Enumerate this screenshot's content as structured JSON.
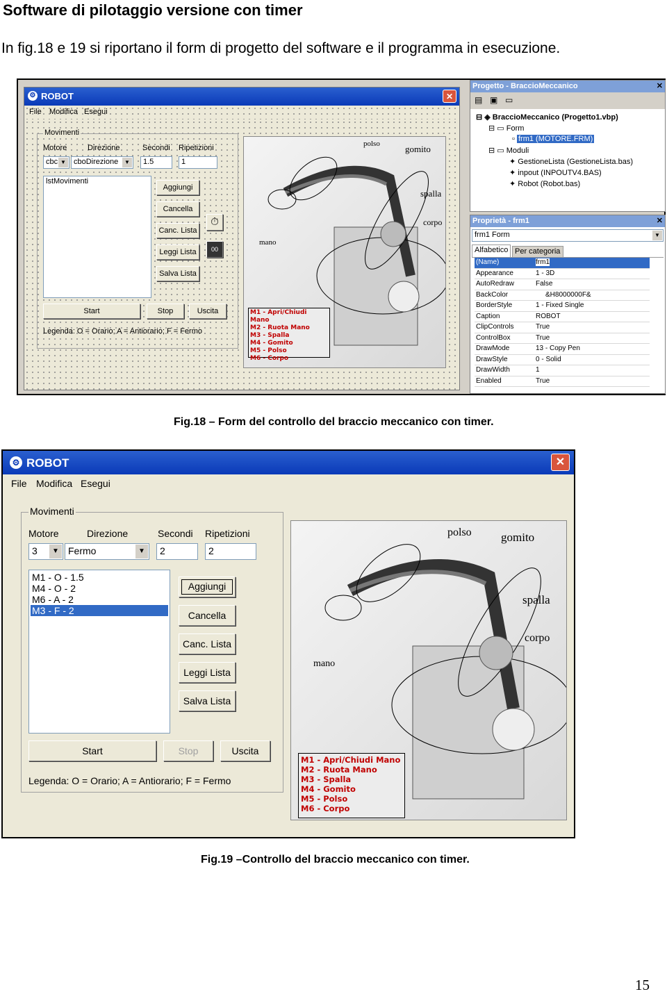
{
  "heading": "Software di pilotaggio versione con timer",
  "intro": "In fig.18 e 19 si riportano il form di progetto del software e il programma in esecuzione.",
  "fig18": {
    "caption": "Fig.18 – Form del controllo del braccio meccanico con timer.",
    "form": {
      "title": "ROBOT",
      "menu": [
        "File",
        "Modifica",
        "Esegui"
      ],
      "group_title": "Movimenti",
      "labels": {
        "motore": "Motore",
        "direzione": "Direzione",
        "secondi": "Secondi",
        "ripetizioni": "Ripetizioni"
      },
      "motore_value": "cbc",
      "direzione_value": "cboDirezione",
      "secondi_value": "1.5",
      "ripetizioni_value": "1",
      "list_name": "lstMovimenti",
      "buttons": {
        "aggiungi": "Aggiungi",
        "cancella": "Cancella",
        "canc_lista": "Canc. Lista",
        "leggi_lista": "Leggi Lista",
        "salva_lista": "Salva Lista",
        "start": "Start",
        "stop": "Stop",
        "uscita": "Uscita"
      },
      "legenda": "Legenda: O = Orario; A = Antiorario; F = Fermo",
      "robot_labels": {
        "polso": "polso",
        "gomito": "gomito",
        "spalla": "spalla",
        "corpo": "corpo",
        "mano": "mano"
      },
      "motor_legend": [
        "M1 - Apri/Chiudi Mano",
        "M2 - Ruota Mano",
        "M3 - Spalla",
        "M4 - Gomito",
        "M5 - Polso",
        "M6 - Corpo"
      ]
    },
    "project": {
      "title": "Progetto - BraccioMeccanico",
      "root": "BraccioMeccanico (Progetto1.vbp)",
      "form_folder": "Form",
      "form_item": "frm1 (MOTORE.FRM)",
      "modules_folder": "Moduli",
      "modules": [
        "GestioneLista (GestioneLista.bas)",
        "inpout (INPOUTV4.BAS)",
        "Robot (Robot.bas)"
      ]
    },
    "properties": {
      "title": "Proprietà - frm1",
      "object": "frm1  Form",
      "tabs": [
        "Alfabetico",
        "Per categoria"
      ],
      "rows": [
        {
          "k": "(Name)",
          "v": "frm1"
        },
        {
          "k": "Appearance",
          "v": "1 - 3D"
        },
        {
          "k": "AutoRedraw",
          "v": "False"
        },
        {
          "k": "BackColor",
          "v": "&H8000000F&"
        },
        {
          "k": "BorderStyle",
          "v": "1 - Fixed Single"
        },
        {
          "k": "Caption",
          "v": "ROBOT"
        },
        {
          "k": "ClipControls",
          "v": "True"
        },
        {
          "k": "ControlBox",
          "v": "True"
        },
        {
          "k": "DrawMode",
          "v": "13 - Copy Pen"
        },
        {
          "k": "DrawStyle",
          "v": "0 - Solid"
        },
        {
          "k": "DrawWidth",
          "v": "1"
        },
        {
          "k": "Enabled",
          "v": "True"
        }
      ]
    }
  },
  "fig19": {
    "caption": "Fig.19 –Controllo del braccio meccanico con timer.",
    "window": {
      "title": "ROBOT",
      "menu": [
        "File",
        "Modifica",
        "Esegui"
      ],
      "group_title": "Movimenti",
      "labels": {
        "motore": "Motore",
        "direzione": "Direzione",
        "secondi": "Secondi",
        "ripetizioni": "Ripetizioni"
      },
      "motore_value": "3",
      "direzione_value": "Fermo",
      "secondi_value": "2",
      "ripetizioni_value": "2",
      "list_items": [
        "M1 - O - 1.5",
        "M4 - O - 2",
        "M6 - A - 2",
        "M3 - F - 2"
      ],
      "buttons": {
        "aggiungi": "Aggiungi",
        "cancella": "Cancella",
        "canc_lista": "Canc. Lista",
        "leggi_lista": "Leggi Lista",
        "salva_lista": "Salva Lista",
        "start": "Start",
        "stop": "Stop",
        "uscita": "Uscita"
      },
      "legenda": "Legenda: O = Orario; A = Antiorario; F = Fermo",
      "robot_labels": {
        "polso": "polso",
        "gomito": "gomito",
        "spalla": "spalla",
        "corpo": "corpo",
        "mano": "mano"
      },
      "motor_legend": [
        "M1 - Apri/Chiudi Mano",
        "M2 - Ruota Mano",
        "M3 - Spalla",
        "M4 - Gomito",
        "M5 - Polso",
        "M6 - Corpo"
      ]
    }
  },
  "page_number": "15"
}
